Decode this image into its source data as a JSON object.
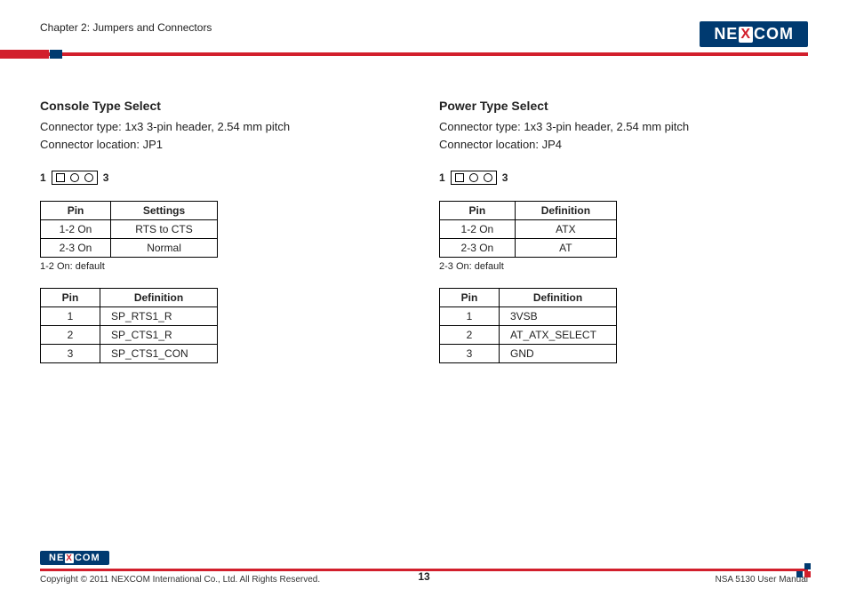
{
  "header": {
    "chapter": "Chapter 2: Jumpers and Connectors",
    "logo_pre": "NE",
    "logo_x": "X",
    "logo_post": "COM"
  },
  "left": {
    "title": "Console Type Select",
    "line1": "Connector type: 1x3 3-pin header, 2.54 mm pitch",
    "line2": "Connector location: JP1",
    "d_left": "1",
    "d_right": "3",
    "t1_h1": "Pin",
    "t1_h2": "Settings",
    "t1_r1c1": "1-2 On",
    "t1_r1c2": "RTS to CTS",
    "t1_r2c1": "2-3 On",
    "t1_r2c2": "Normal",
    "defnote": "1-2 On: default",
    "t2_h1": "Pin",
    "t2_h2": "Definition",
    "t2_r1c1": "1",
    "t2_r1c2": "SP_RTS1_R",
    "t2_r2c1": "2",
    "t2_r2c2": "SP_CTS1_R",
    "t2_r3c1": "3",
    "t2_r3c2": "SP_CTS1_CON"
  },
  "right": {
    "title": "Power Type Select",
    "line1": "Connector type: 1x3 3-pin header, 2.54 mm pitch",
    "line2": "Connector location: JP4",
    "d_left": "1",
    "d_right": "3",
    "t1_h1": "Pin",
    "t1_h2": "Definition",
    "t1_r1c1": "1-2 On",
    "t1_r1c2": "ATX",
    "t1_r2c1": "2-3 On",
    "t1_r2c2": "AT",
    "defnote": "2-3 On: default",
    "t2_h1": "Pin",
    "t2_h2": "Definition",
    "t2_r1c1": "1",
    "t2_r1c2": "3VSB",
    "t2_r2c1": "2",
    "t2_r2c2": "AT_ATX_SELECT",
    "t2_r3c1": "3",
    "t2_r3c2": "GND"
  },
  "footer": {
    "copyright": "Copyright © 2011 NEXCOM International Co., Ltd. All Rights Reserved.",
    "pagenum": "13",
    "manual": "NSA 5130 User Manual",
    "logo_pre": "NE",
    "logo_x": "X",
    "logo_post": "COM"
  }
}
